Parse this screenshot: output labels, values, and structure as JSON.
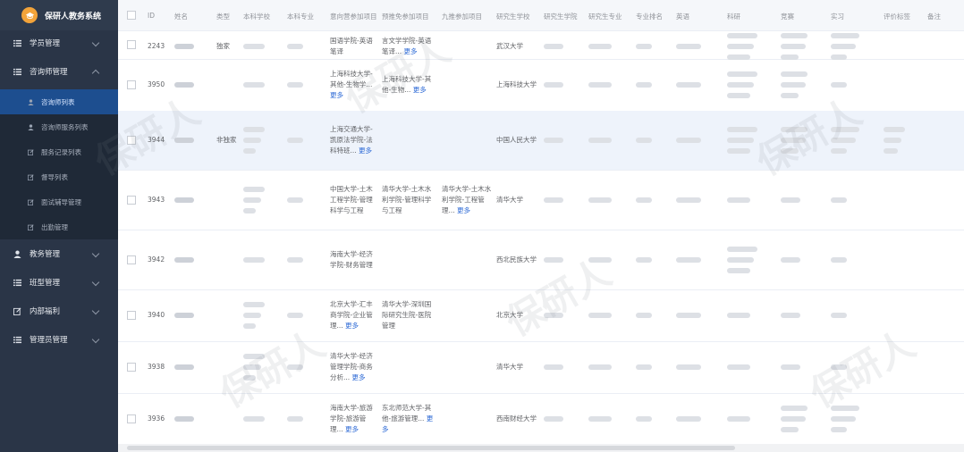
{
  "app": {
    "title": "保研人教务系统"
  },
  "sidebar": {
    "items": [
      {
        "label": "学员管理",
        "icon": "list-icon",
        "expanded": false
      },
      {
        "label": "咨询师管理",
        "icon": "list-icon",
        "expanded": true
      },
      {
        "label": "教务管理",
        "icon": "user-icon",
        "expanded": false
      },
      {
        "label": "班型管理",
        "icon": "list-icon",
        "expanded": false
      },
      {
        "label": "内部福利",
        "icon": "edit-icon",
        "expanded": false
      },
      {
        "label": "管理员管理",
        "icon": "list-icon",
        "expanded": false
      }
    ],
    "subitems": [
      "咨询师列表",
      "咨询师服务列表",
      "服务记录列表",
      "督导列表",
      "面试辅导管理",
      "出勤管理"
    ]
  },
  "table": {
    "headers": [
      "ID",
      "姓名",
      "类型",
      "本科学校",
      "本科专业",
      "意向营参加项目",
      "预推免参加项目",
      "九推参加项目",
      "研究生学校",
      "研究生学院",
      "研究生专业",
      "专业排名",
      "英语",
      "科研",
      "竞赛",
      "实习",
      "评价标签",
      "备注"
    ],
    "rows": [
      {
        "id": "2243",
        "type": "独家",
        "camp": "国语学院-英语笔译",
        "camp_more": "",
        "pre": "言文学学院-英语笔译...",
        "pre_more": "更多",
        "nine": "",
        "nine_more": "",
        "grad_school": "武汉大学"
      },
      {
        "id": "3950",
        "type": "",
        "camp": "上海科技大学-其他-生物学...",
        "camp_more": "更多",
        "pre": "上海科技大学-其他-生物...",
        "pre_more": "更多",
        "nine": "",
        "nine_more": "",
        "grad_school": "上海科技大学"
      },
      {
        "id": "3944",
        "type": "非独家",
        "camp": "上海交通大学-凯原法学院-法科特班...",
        "camp_more": "更多",
        "pre": "",
        "pre_more": "",
        "nine": "",
        "nine_more": "",
        "grad_school": "中国人民大学"
      },
      {
        "id": "3943",
        "type": "",
        "camp": "中国大学-土木工程学院-管理科学与工程",
        "camp_more": "",
        "pre": "清华大学-土木水利学院-管理科学与工程",
        "pre_more": "",
        "nine": "清华大学-土木水利学院-工程管理...",
        "nine_more": "更多",
        "grad_school": "清华大学"
      },
      {
        "id": "3942",
        "type": "",
        "camp": "海南大学-经济学院-财务管理",
        "camp_more": "",
        "pre": "",
        "pre_more": "",
        "nine": "",
        "nine_more": "",
        "grad_school": "西北民族大学"
      },
      {
        "id": "3940",
        "type": "",
        "camp": "北京大学-汇丰商学院-企业管理...",
        "camp_more": "更多",
        "pre": "清华大学-深圳国际研究生院-医院管理",
        "pre_more": "",
        "nine": "",
        "nine_more": "",
        "grad_school": "北京大学"
      },
      {
        "id": "3938",
        "type": "",
        "camp": "清华大学-经济管理学院-商务分析...",
        "camp_more": "更多",
        "pre": "",
        "pre_more": "",
        "nine": "",
        "nine_more": "",
        "grad_school": "清华大学"
      },
      {
        "id": "3936",
        "type": "",
        "camp": "海南大学-旅游学院-旅游管理...",
        "camp_more": "更多",
        "pre": "东北师范大学-其他-旅游管理...",
        "pre_more": "更多",
        "nine": "",
        "nine_more": "",
        "grad_school": "西南财经大学"
      }
    ]
  },
  "colors": {
    "sidebar_bg": "#2a3547",
    "active_bg": "#1d4e8f",
    "link": "#2d6ad6",
    "logo": "#f2a33a"
  }
}
